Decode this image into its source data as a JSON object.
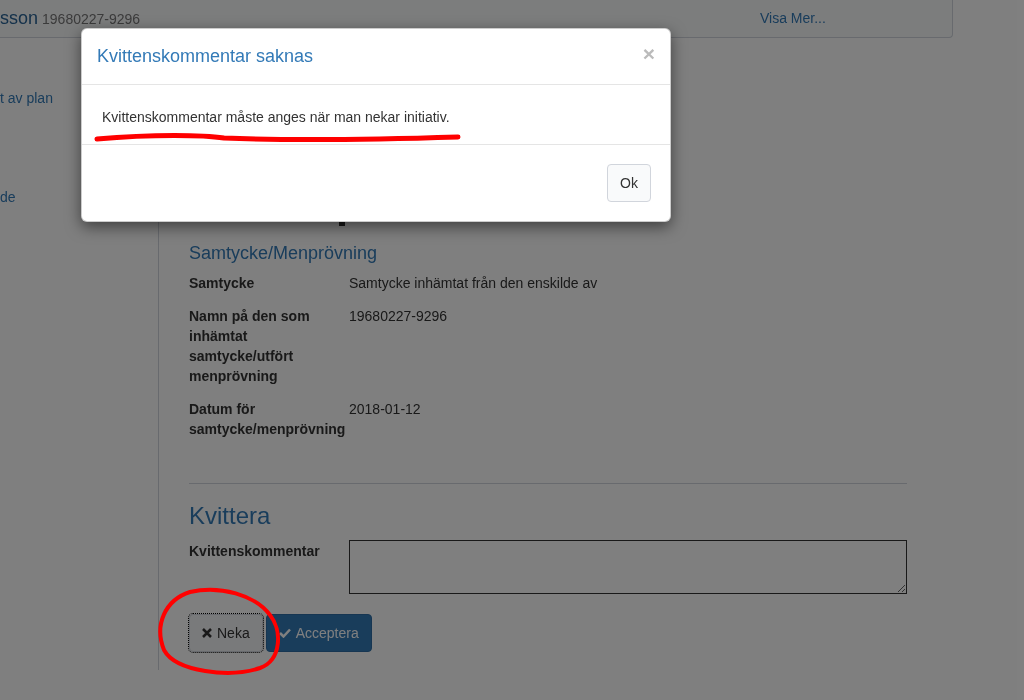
{
  "header": {
    "name": "sson",
    "id_number": "19680227-9296",
    "link": "Visa Mer..."
  },
  "sidebar": {
    "items": [
      {
        "label": "t av plan"
      },
      {
        "label": "de"
      }
    ]
  },
  "consent": {
    "title": "Samtycke/Menprövning",
    "fields": [
      {
        "label": "Samtycke",
        "value": "Samtycke inhämtat från den enskilde av"
      },
      {
        "label": "Namn på den som inhämtat samtycke/utfört menprövning",
        "value": "19680227-9296"
      },
      {
        "label": "Datum för samtycke/menprövning",
        "value": "2018-01-12"
      }
    ]
  },
  "receipt": {
    "title": "Kvittera",
    "comment_label": "Kvittenskommentar",
    "buttons": [
      {
        "label": "Neka",
        "kind": "deny",
        "focused": true
      },
      {
        "label": "Acceptera",
        "kind": "accept",
        "focused": false
      }
    ]
  },
  "modal": {
    "title": "Kvittenskommentar saknas",
    "close": "×",
    "message": "Kvittenskommentar måste anges när man nekar initiativ.",
    "button": "Ok"
  }
}
